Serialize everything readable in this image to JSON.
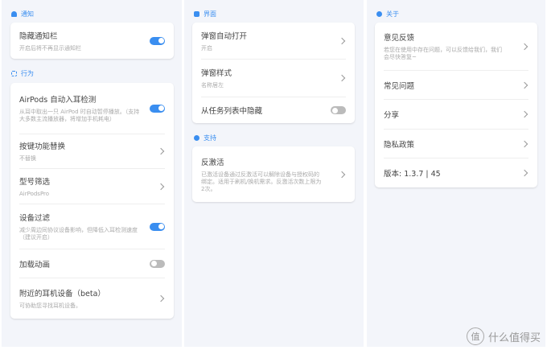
{
  "left": {
    "notify_header": "通知",
    "hide_bar": {
      "title": "隐藏通知栏",
      "sub": "开启后将不再显示通知栏",
      "on": true
    },
    "behavior_header": "行为",
    "rows": [
      {
        "title": "AirPods 自动入耳检测",
        "sub": "从耳中取出一只 AirPod 时自动暂停播放。（支持大多数主流播放器，将增加手机耗电）",
        "on": true
      },
      {
        "title": "按键功能替换",
        "sub": "不替换"
      },
      {
        "title": "型号筛选",
        "sub": "AirPodsPro"
      },
      {
        "title": "设备过滤",
        "sub": "减少周边同协议设备影响，但降低入耳检测速度（建议开启）",
        "on": true
      },
      {
        "title": "加载动画",
        "on": false
      },
      {
        "title": "附近的耳机设备（beta）",
        "sub": "可协助您寻找耳机设备。"
      }
    ]
  },
  "middle": {
    "ui_header": "界面",
    "rows": [
      {
        "title": "弹窗自动打开",
        "sub": "开启"
      },
      {
        "title": "弹窗样式",
        "sub": "名称居左"
      },
      {
        "title": "从任务列表中隐藏",
        "on": false
      }
    ],
    "support_header": "支持",
    "deactivate": {
      "title": "反激活",
      "sub": "已激活设备通过反激活可以解除设备与授权码的绑定。适用于刷机/换机需求。反激活次数上限为2次。"
    }
  },
  "right": {
    "about_header": "关于",
    "rows": [
      {
        "title": "意见反馈",
        "sub": "若您在使用中存在问题，可以反馈给我们，我们会尽快答复~"
      },
      {
        "title": "常见问题"
      },
      {
        "title": "分享"
      },
      {
        "title": "隐私政策"
      },
      {
        "title": "版本: 1.3.7 | 45"
      }
    ]
  },
  "watermark": {
    "logo": "值",
    "text": "什么值得买"
  },
  "colors": {
    "accent": "#3a8ef0",
    "bg": "#f3f5fa"
  }
}
